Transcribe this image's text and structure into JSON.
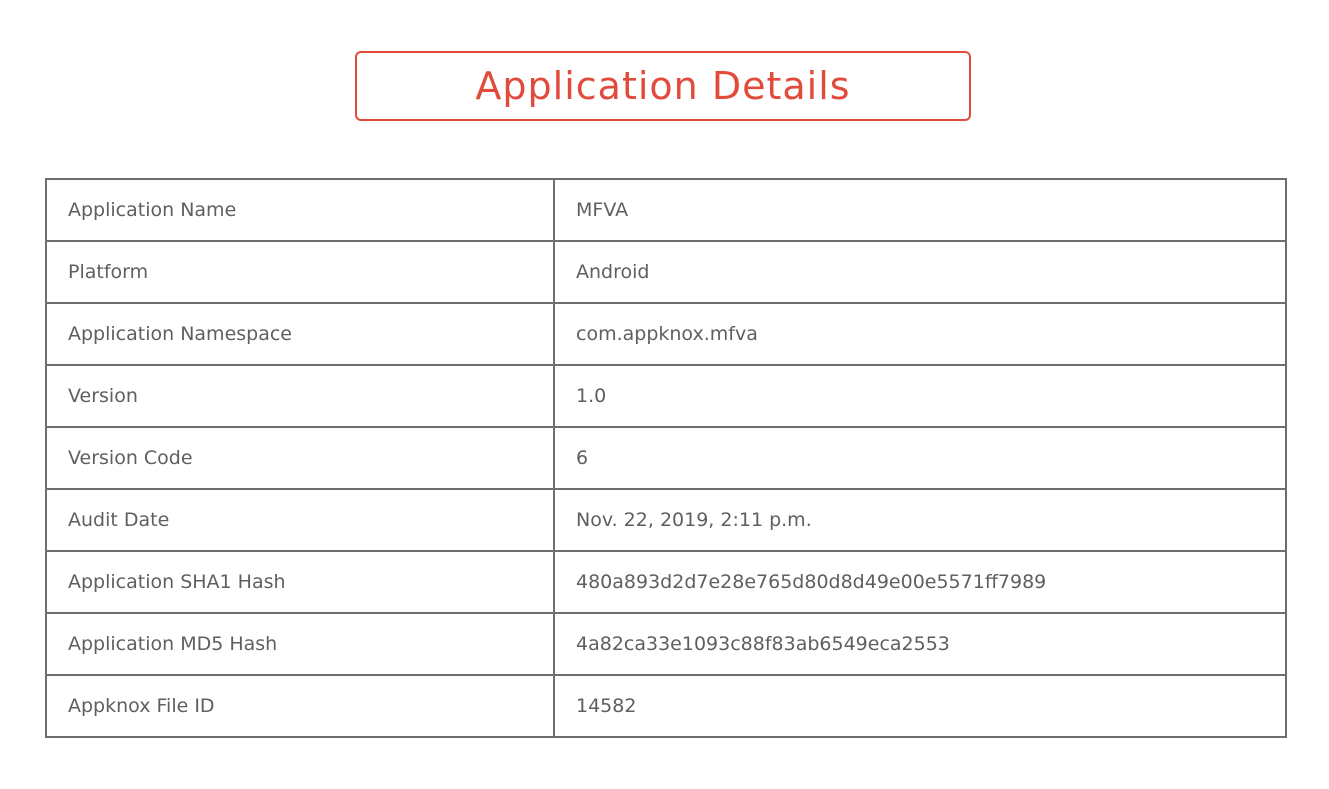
{
  "header": {
    "title": "Application Details"
  },
  "colors": {
    "accent": "#e24b3b",
    "text": "#5f5f5f",
    "border": "#6e6e6e"
  },
  "details": [
    {
      "label": "Application Name",
      "value": "MFVA"
    },
    {
      "label": "Platform",
      "value": "Android"
    },
    {
      "label": "Application Namespace",
      "value": "com.appknox.mfva"
    },
    {
      "label": "Version",
      "value": "1.0"
    },
    {
      "label": "Version Code",
      "value": "6"
    },
    {
      "label": "Audit Date",
      "value": "Nov. 22, 2019, 2:11 p.m."
    },
    {
      "label": "Application SHA1 Hash",
      "value": "480a893d2d7e28e765d80d8d49e00e5571ff7989"
    },
    {
      "label": "Application MD5 Hash",
      "value": "4a82ca33e1093c88f83ab6549eca2553"
    },
    {
      "label": "Appknox File ID",
      "value": "14582"
    }
  ]
}
